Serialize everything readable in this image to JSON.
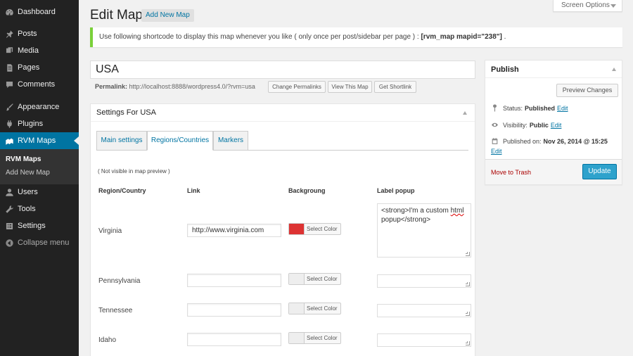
{
  "sidebar": {
    "items": [
      {
        "label": "Dashboard",
        "icon": "dashboard-icon"
      },
      {
        "label": "Posts",
        "icon": "pin-icon"
      },
      {
        "label": "Media",
        "icon": "media-icon"
      },
      {
        "label": "Pages",
        "icon": "pages-icon"
      },
      {
        "label": "Comments",
        "icon": "comment-icon"
      },
      {
        "label": "Appearance",
        "icon": "brush-icon"
      },
      {
        "label": "Plugins",
        "icon": "plugin-icon"
      },
      {
        "label": "RVM Maps",
        "icon": "map-icon",
        "active": true
      },
      {
        "label": "Users",
        "icon": "users-icon"
      },
      {
        "label": "Tools",
        "icon": "wrench-icon"
      },
      {
        "label": "Settings",
        "icon": "settings-icon"
      }
    ],
    "submenu": [
      {
        "label": "RVM Maps",
        "current": true
      },
      {
        "label": "Add New Map"
      }
    ],
    "collapse_label": "Collapse menu"
  },
  "header": {
    "title": "Edit Map",
    "add_new_label": "Add New Map",
    "screen_options_label": "Screen Options"
  },
  "notice": {
    "text": "Use following shortcode to display this map whenever you like ( only once per post/sidebar per page ) :",
    "shortcode": "[rvm_map mapid=\"238\"]",
    "suffix": "."
  },
  "editor": {
    "title_value": "USA",
    "permalink_label": "Permalink:",
    "permalink_url": "http://localhost:8888/wordpress4.0/?rvm=usa",
    "buttons": [
      "Change Permalinks",
      "View This Map",
      "Get Shortlink"
    ]
  },
  "settings": {
    "title": "Settings For USA",
    "tabs": [
      "Main settings",
      "Regions/Countries",
      "Markers"
    ],
    "active_tab": "Regions/Countries",
    "note": "( Not visible in map preview )",
    "columns": [
      "Region/Country",
      "Link",
      "Backgroung",
      "Label popup"
    ],
    "select_color_label": "Select Color",
    "rows": [
      {
        "region": "Virginia",
        "link": "http://www.virginia.com",
        "color": "#dd3333",
        "popup_line1": "<strong>I'm a custom ",
        "popup_spell": "html",
        "popup_line2": "popup</strong>"
      },
      {
        "region": "Pennsylvania",
        "link": "",
        "color": "",
        "popup_line1": "",
        "popup_spell": "",
        "popup_line2": ""
      },
      {
        "region": "Tennessee",
        "link": "",
        "color": "",
        "popup_line1": "",
        "popup_spell": "",
        "popup_line2": ""
      },
      {
        "region": "Idaho",
        "link": "",
        "color": "",
        "popup_line1": "",
        "popup_spell": "",
        "popup_line2": ""
      }
    ]
  },
  "publish": {
    "title": "Publish",
    "preview_label": "Preview Changes",
    "status_label": "Status:",
    "status_value": "Published",
    "visibility_label": "Visibility:",
    "visibility_value": "Public",
    "published_label": "Published on:",
    "published_value": "Nov 26, 2014 @ 15:25",
    "edit_label": "Edit",
    "trash_label": "Move to Trash",
    "update_label": "Update"
  },
  "colors": {
    "sidebar_bg": "#222222",
    "active_menu": "#0074a2",
    "notice_border": "#7ad03a",
    "update_button": "#2ea2cc",
    "trash_link": "#aa0000"
  }
}
